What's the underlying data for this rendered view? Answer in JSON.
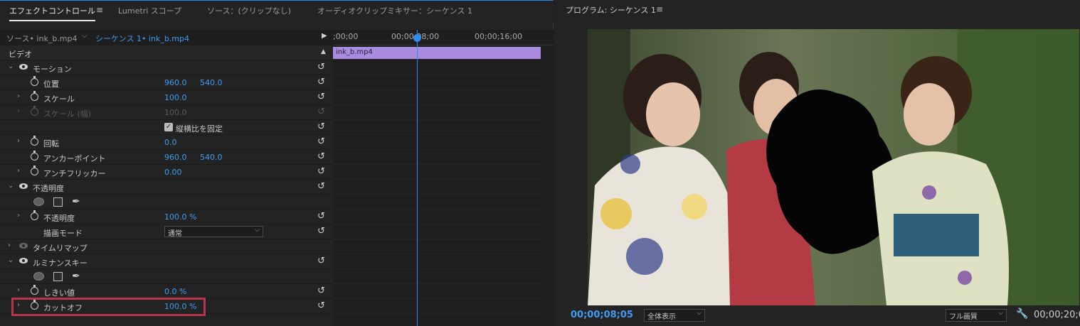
{
  "left_panel": {
    "tabs": [
      {
        "label": "エフェクトコントロール",
        "active": true
      },
      {
        "label": "Lumetri スコープ",
        "active": false
      },
      {
        "label": "ソース：(クリップなし)",
        "active": false
      },
      {
        "label": "オーディオクリップミキサー：シーケンス 1",
        "active": false
      }
    ],
    "menu_icon": "≡",
    "source_label": "ソース• ink_b.mp4",
    "sequence_label": "シーケンス 1• ink_b.mp4",
    "section_label": "ビデオ",
    "rows": {
      "motion": {
        "label": "モーション"
      },
      "position": {
        "label": "位置",
        "v1": "960.0",
        "v2": "540.0"
      },
      "scale": {
        "label": "スケール",
        "v1": "100.0"
      },
      "scale_width": {
        "label": "スケール (幅)",
        "v1": "100.0"
      },
      "lock_aspect": {
        "label": "縦横比を固定"
      },
      "rotation": {
        "label": "回転",
        "v1": "0.0"
      },
      "anchor": {
        "label": "アンカーポイント",
        "v1": "960.0",
        "v2": "540.0"
      },
      "antiflicker": {
        "label": "アンチフリッカー",
        "v1": "0.00"
      },
      "opacity_group": {
        "label": "不透明度"
      },
      "opacity": {
        "label": "不透明度",
        "v1": "100.0 %"
      },
      "blend_mode": {
        "label": "描画モード",
        "v1": "通常"
      },
      "time_remap": {
        "label": "タイムリマップ"
      },
      "luma_key": {
        "label": "ルミナンスキー"
      },
      "threshold": {
        "label": "しきい値",
        "v1": "0.0 %"
      },
      "cutoff": {
        "label": "カットオフ",
        "v1": "100.0 %"
      }
    },
    "timeline": {
      "tick_labels": [
        ";00;00",
        "00;00;08;00",
        "00;00;16;00"
      ],
      "clip_name": "ink_b.mp4"
    },
    "accent_color": "#2d8ceb",
    "highlight_color": "#b8354a"
  },
  "right_panel": {
    "title": "プログラム: シーケンス 1",
    "menu_icon": "≡",
    "current_timecode": "00;00;08;05",
    "zoom_select": "全体表示",
    "quality_select": "フル画質",
    "duration_timecode": "00;00;20;0"
  }
}
